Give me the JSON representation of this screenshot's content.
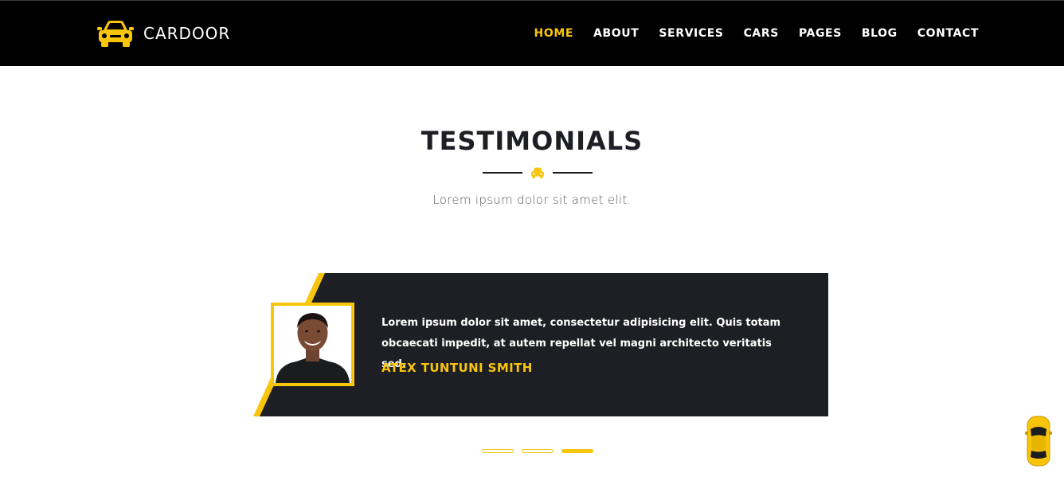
{
  "brand": {
    "name": "CARDOOR",
    "icon": "car-front-icon",
    "accent_color": "#f8c50b",
    "dark_color": "#1e1f24"
  },
  "nav": {
    "items": [
      {
        "label": "HOME",
        "active": true
      },
      {
        "label": "ABOUT",
        "active": false
      },
      {
        "label": "SERVICES",
        "active": false
      },
      {
        "label": "CARS",
        "active": false
      },
      {
        "label": "PAGES",
        "active": false
      },
      {
        "label": "BLOG",
        "active": false
      },
      {
        "label": "CONTACT",
        "active": false
      }
    ]
  },
  "testimonials": {
    "title": "TESTIMONIALS",
    "divider_icon": "car-icon",
    "subtitle": "Lorem ipsum dolor sit amet elit.",
    "current": {
      "quote": "Lorem ipsum dolor sit amet, consectetur adipisicing elit. Quis totam obcaecati impedit, at autem repellat vel magni architecto veritatis sed.",
      "author": "ATEX TUNTUNI SMITH",
      "avatar_icon": "person-photo"
    },
    "pagination": {
      "count": 3,
      "active_index": 2
    }
  },
  "floating_button": {
    "icon": "car-top-view-icon"
  }
}
